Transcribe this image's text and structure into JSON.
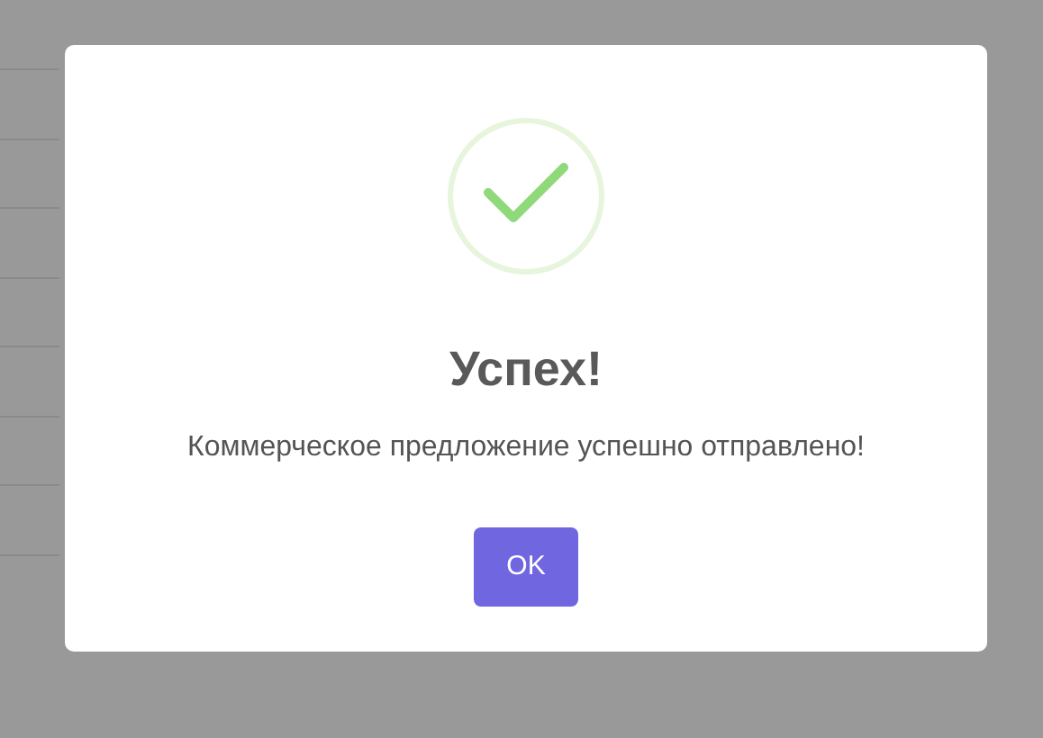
{
  "dialog": {
    "icon": {
      "kind": "success"
    },
    "title": "Успех!",
    "message": "Коммерческое предложение успешно отправлено!",
    "buttons": [
      "OK"
    ]
  }
}
